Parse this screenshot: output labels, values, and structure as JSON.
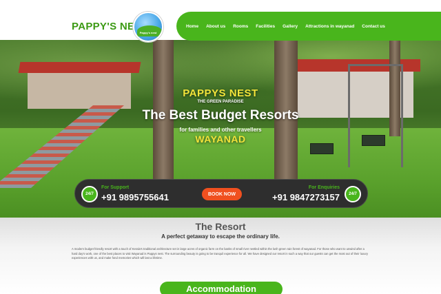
{
  "header": {
    "brand": "PAPPY'S NEST",
    "logo_text": "Pappy's nest",
    "nav": [
      "Home",
      "About us",
      "Rooms",
      "Facilities",
      "Gallery",
      "Attractions in wayanad",
      "Contact us"
    ]
  },
  "hero": {
    "brand": "PAPPYS NEST",
    "tagline": "THE GREEN PARADISE",
    "title": "The Best Budget Resorts",
    "subtitle": "for families and other travellers",
    "location": "WAYANAD"
  },
  "contact": {
    "support_label": "For Support",
    "support_phone": "+91 9895755641",
    "book_label": "BOOK NOW",
    "enquiry_label": "For Enquiries",
    "enquiry_phone": "+91 9847273157",
    "badge_text": "24/7"
  },
  "resort": {
    "title": "The Resort",
    "subtitle": "A perfect getaway to escape the ordinary life.",
    "body": "A modern budget friendly resort with a touch of Kerala's traditional architecture set in large acres of organic farm on the banks of small river nestled within the lush green rain forest of wayanad. For those who want to unwind after a hard day's work, one of the best places to visit Wayanad is Pappys nest. The surrounding beauty is going to be tranquil experience for all. We have designed our resort in such a way that our guests can get the most out of their luxury experiences with us, and make fond memories which will last a lifetime.",
    "accommodation_label": "Accommodation"
  },
  "colors": {
    "green": "#49b51c",
    "yellow": "#f2e43a",
    "orange": "#f0501f",
    "dark": "#2e2e2e"
  }
}
